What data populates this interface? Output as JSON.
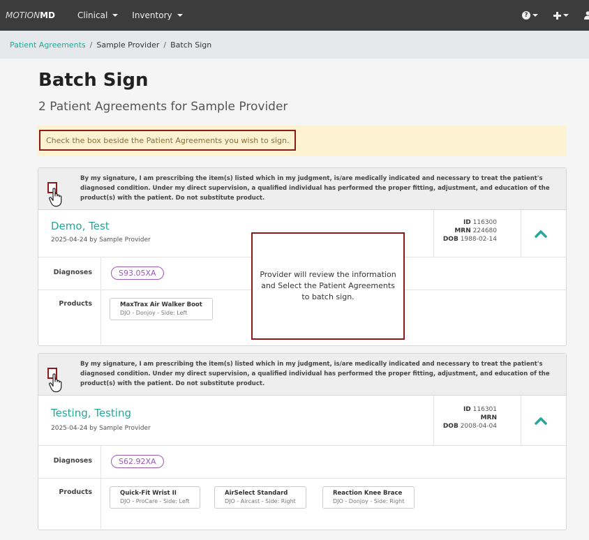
{
  "nav": {
    "brand_light": "MOTION",
    "brand_bold": "MD",
    "menu": [
      "Clinical",
      "Inventory"
    ],
    "help_icon": "question-circle-icon",
    "add_icon": "plus-icon",
    "user_icon": "user-icon"
  },
  "breadcrumb": {
    "link": "Patient Agreements",
    "items": [
      "Sample Provider",
      "Batch Sign"
    ]
  },
  "page": {
    "title": "Batch Sign",
    "subtitle": "2 Patient Agreements for Sample Provider"
  },
  "alert": {
    "text": "Check the box beside the Patient Agreements you wish to sign."
  },
  "signature_text": "By my signature, I am prescribing the item(s) listed which in my judgment, is/are medically indicated and necessary to treat the patient's diagnosed condition. Under my direct supervision, a qualified individual has performed the proper fitting, adjustment, and education of the product(s) with the patient. Do not substitute product.",
  "labels": {
    "diagnoses": "Diagnoses",
    "products": "Products",
    "id": "ID",
    "mrn": "MRN",
    "dob": "DOB"
  },
  "agreements": [
    {
      "name": "Demo, Test",
      "meta": "2025-04-24 by Sample Provider",
      "id": "116300",
      "mrn": "224680",
      "dob": "1988-02-14",
      "diagnosis": "S93.05XA",
      "products": [
        {
          "name": "MaxTrax Air Walker Boot",
          "sub": "DJO - Donjoy - Side: Left"
        }
      ]
    },
    {
      "name": "Testing, Testing",
      "meta": "2025-04-24 by Sample Provider",
      "id": "116301",
      "mrn": "",
      "dob": "2008-04-04",
      "diagnosis": "S62.92XA",
      "products": [
        {
          "name": "Quick-Fit Wrist II",
          "sub": "DJO - ProCare - Side: Left"
        },
        {
          "name": "AirSelect Standard",
          "sub": "DJO - Aircast - Side: Right"
        },
        {
          "name": "Reaction Knee Brace",
          "sub": "DJO - Donjoy - Side: Right"
        }
      ]
    }
  ],
  "callout": {
    "text": "Provider will review the information and Select the Patient Agreements to batch sign."
  },
  "colors": {
    "accent": "#26a69a",
    "diagnosis": "#9b59b6",
    "highlight_border": "#8b1a1a",
    "alert_bg": "#fdf3d2",
    "navbar": "#3c3c3c"
  }
}
